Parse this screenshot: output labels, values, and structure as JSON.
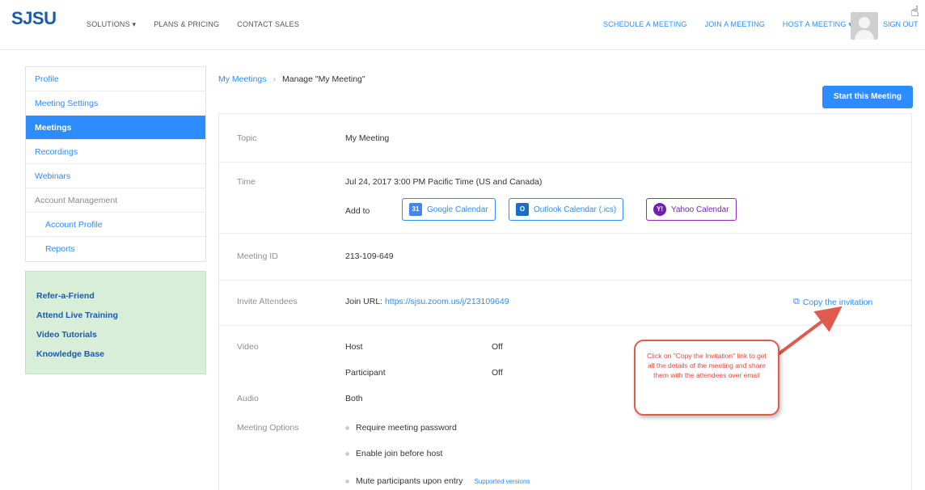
{
  "topnav": {
    "logo": "SJSU",
    "left_links": [
      "SOLUTIONS ▾",
      "PLANS & PRICING",
      "CONTACT SALES"
    ],
    "right_links": [
      "SCHEDULE A MEETING",
      "JOIN A MEETING",
      "HOST A MEETING ▾"
    ],
    "sign_out": "SIGN OUT"
  },
  "sidebar": {
    "items": [
      {
        "label": "Profile"
      },
      {
        "label": "Meeting Settings"
      },
      {
        "label": "Meetings"
      },
      {
        "label": "Recordings"
      },
      {
        "label": "Webinars"
      },
      {
        "label": "Account Management"
      },
      {
        "label": "Account Profile"
      },
      {
        "label": "Reports"
      }
    ],
    "active": "Meetings",
    "promo_links": [
      "Refer-a-Friend",
      "Attend Live Training",
      "Video Tutorials",
      "Knowledge Base"
    ]
  },
  "breadcrumb": {
    "parent": "My Meetings",
    "separator": "›",
    "current": "Manage \"My Meeting\""
  },
  "start_button": "Start this Meeting",
  "meeting": {
    "topic_label": "Topic",
    "topic": "My Meeting",
    "time_label": "Time",
    "time": "Jul 24, 2017 3:00 PM Pacific Time (US and Canada)",
    "add_to_label": "Add to",
    "calendars": [
      "Google Calendar",
      "Outlook Calendar (.ics)",
      "Yahoo Calendar"
    ],
    "meeting_id_label": "Meeting ID",
    "meeting_id": "213-109-649",
    "invite_label": "Invite Attendees",
    "join_url_prefix": "Join URL:",
    "join_url": "https://sjsu.zoom.us/j/213109649",
    "copy_invitation": "Copy the invitation",
    "video_label": "Video",
    "host_label": "Host",
    "host_value": "Off",
    "participant_label": "Participant",
    "participant_value": "Off",
    "audio_label": "Audio",
    "audio_value": "Both",
    "options_label": "Meeting Options",
    "options": [
      "Require meeting password",
      "Enable join before host",
      "Mute participants upon entry"
    ],
    "supported_versions": "Supported versions"
  },
  "callout": {
    "text": "Click on \"Copy the Invitation\" link to get all the details of the meeting and share them with the attendees over email"
  },
  "colors": {
    "brand_blue": "#2d8cff",
    "logo_blue": "#1a5aa8",
    "callout_red": "#e24a3c",
    "promo_green": "#d9eed9"
  }
}
